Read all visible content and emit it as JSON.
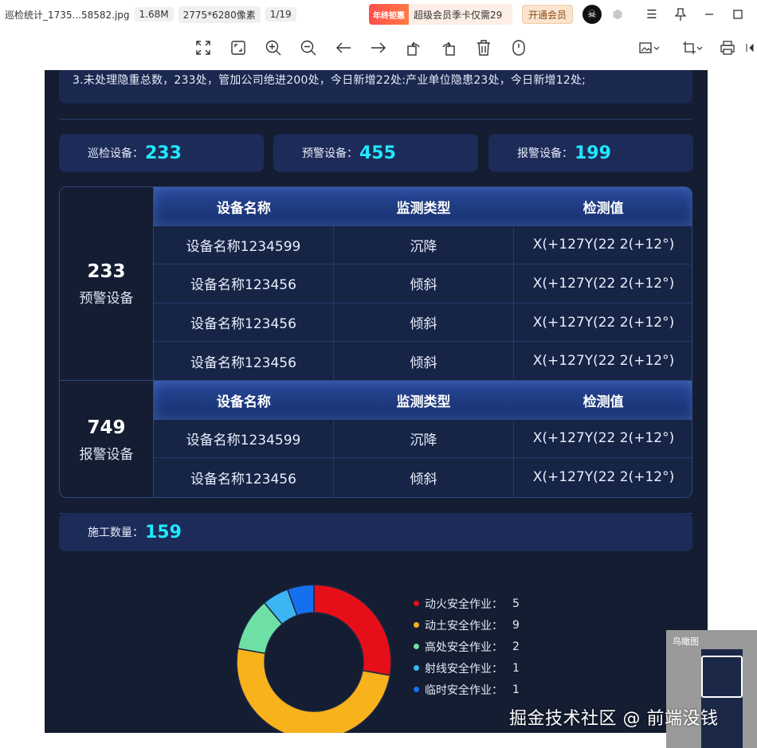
{
  "titlebar": {
    "filename": "巡检统计_1735...58582.jpg",
    "filesize": "1.68M",
    "dimensions": "2775*6280像素",
    "page": "1/19",
    "promo_tag": "年终钜惠",
    "promo_text": "超级会员季卡仅需29",
    "vip_button": "开通会员"
  },
  "toolbar": {
    "icons": [
      "fit-screen-icon",
      "original-size-icon",
      "zoom-in-icon",
      "zoom-out-icon",
      "previous-icon",
      "next-icon",
      "rotate-left-icon",
      "rotate-right-icon",
      "delete-icon",
      "more-icon",
      "image-edit-icon",
      "crop-icon",
      "print-icon"
    ]
  },
  "dashboard": {
    "notice": "3.未处理隐重总数，233处，管加公司绝进200处，今日新增22处:产业单位隐患23处，今日新增12处;",
    "stats": [
      {
        "label": "巡检设备：",
        "value": "233"
      },
      {
        "label": "预警设备：",
        "value": "455"
      },
      {
        "label": "报警设备：",
        "value": "199"
      }
    ],
    "warning_section": {
      "count": "233",
      "label": "预警设备",
      "headers": [
        "设备名称",
        "监测类型",
        "检测值"
      ],
      "rows": [
        [
          "设备名称1234599",
          "沉降",
          "X(+127Y(22 2(+12°)"
        ],
        [
          "设备名称123456",
          "倾斜",
          "X(+127Y(22 2(+12°)"
        ],
        [
          "设备名称123456",
          "倾斜",
          "X(+127Y(22 2(+12°)"
        ],
        [
          "设备名称123456",
          "倾斜",
          "X(+127Y(22 2(+12°)"
        ]
      ]
    },
    "alarm_section": {
      "count": "749",
      "label": "报警设备",
      "headers": [
        "设备名称",
        "监测类型",
        "检测值"
      ],
      "rows": [
        [
          "设备名称1234599",
          "沉降",
          "X(+127Y(22 2(+12°)"
        ],
        [
          "设备名称123456",
          "倾斜",
          "X(+127Y(22 2(+12°)"
        ]
      ]
    },
    "construction": {
      "label": "施工数量：",
      "value": "159"
    }
  },
  "chart_data": {
    "type": "pie",
    "donut": true,
    "categories": [
      "动火安全作业：",
      "动土安全作业：",
      "高处安全作业：",
      "射线安全作业：",
      "临时安全作业："
    ],
    "values": [
      5,
      9,
      2,
      1,
      1
    ],
    "colors": [
      "#e60f19",
      "#f8b21c",
      "#6fe0a5",
      "#3cb6f2",
      "#1570f0"
    ],
    "legend": "right"
  },
  "overview": {
    "title": "鸟瞰图"
  },
  "watermark": "掘金技术社区 @ 前端没钱"
}
